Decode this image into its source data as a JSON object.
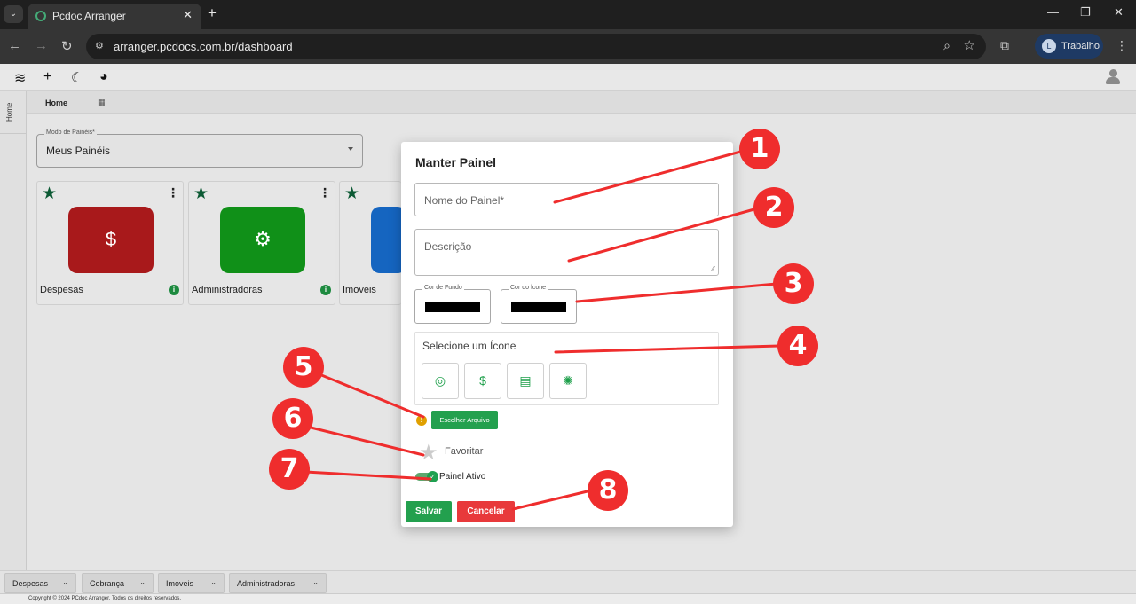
{
  "browser": {
    "tab_title": "Pcdoc Arranger",
    "url": "arranger.pcdocs.com.br/dashboard",
    "profile_initial": "L",
    "profile_name": "Trabalho"
  },
  "app": {
    "breadcrumb": "Home",
    "rail_label": "Home",
    "mode_label": "Modo de Painéis*",
    "mode_value": "Meus Painéis",
    "cards": [
      {
        "label": "Despesas",
        "color": "#a8191b"
      },
      {
        "label": "Administradoras",
        "color": "#109018"
      },
      {
        "label": "Imoveis",
        "color": "#1565c0"
      }
    ],
    "bottom_tabs": [
      "Despesas",
      "Cobrança",
      "Imoveis",
      "Administradoras"
    ],
    "footer": "Copyright © 2024 PCdoc Arranger. Todos os direitos reservados."
  },
  "modal": {
    "title": "Manter Painel",
    "name_placeholder": "Nome do Painel*",
    "desc_placeholder": "Descrição",
    "bg_color_label": "Cor de Fundo",
    "icon_color_label": "Cor do Ícone",
    "bg_color_value": "#000000",
    "icon_color_value": "#000000",
    "icon_select_title": "Selecione um Ícone",
    "icons": [
      "target-icon",
      "money-hand-icon",
      "chat-icon",
      "bug-icon"
    ],
    "upload_label": "Escolher Arquivo",
    "favorite_label": "Favoritar",
    "active_label": "Painel Ativo",
    "save_label": "Salvar",
    "cancel_label": "Cancelar"
  },
  "annotations": [
    "1",
    "2",
    "3",
    "4",
    "5",
    "6",
    "7",
    "8"
  ],
  "colors": {
    "accent_green": "#23a04e",
    "cancel_red": "#e8393b",
    "annotation_red": "#ef2d2d"
  }
}
